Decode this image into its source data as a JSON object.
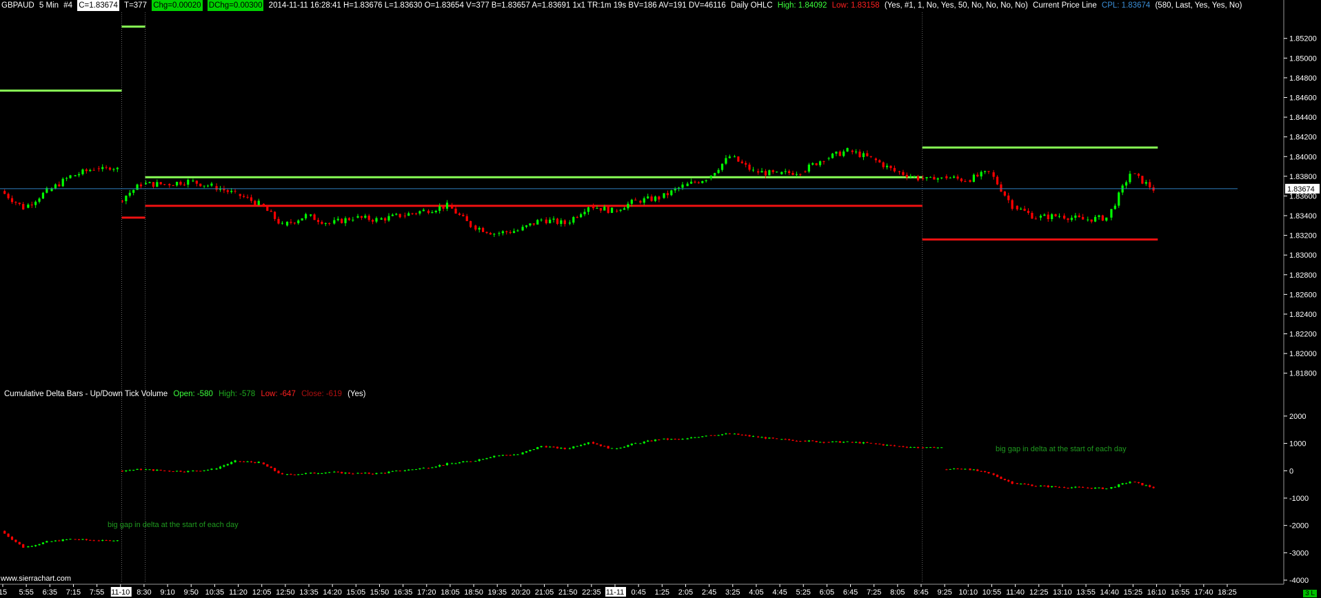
{
  "header": {
    "symbol": "GBPAUD",
    "interval": "5 Min",
    "chart_num": "#4",
    "close_box": "C=1.83674",
    "ticks": "T=377",
    "chg_box": "Chg=0.00020",
    "dchg_box": "DChg=0.00300",
    "bar_info": "2014-11-11 16:28:41 H=1.83676 L=1.83630 O=1.83654 V=377 B=1.83657 A=1.83691 1x1 TR:1m 19s BV=186 AV=191 DV=46116",
    "ohlc_title": "Daily OHLC",
    "ohlc_high": "High: 1.84092",
    "ohlc_low": "Low: 1.83158",
    "ohlc_settings": "(Yes, #1, 1, No, Yes, 50, No, No, No, No)",
    "cpl_title": "Current Price Line",
    "cpl_value": "CPL: 1.83674",
    "cpl_settings": "(580, Last, Yes, Yes, No)"
  },
  "subgraph": {
    "title": "Cumulative Delta Bars - Up/Down Tick Volume",
    "open": "Open: -580",
    "high": "High: -578",
    "low": "Low: -647",
    "close": "Close: -619",
    "settings": "(Yes)"
  },
  "annotations": {
    "note_1": "big gap in delta at the start of each day",
    "note_2": "big gap in delta at the start of each day"
  },
  "watermark": "www.sierrachart.com",
  "corner_tag": "3 L",
  "colors": {
    "up": "#00ff00",
    "down": "#ff0000",
    "cpl": "#2f7fc0",
    "high_line": "#88ff55",
    "low_line": "#ee1111",
    "scale_text": "#ffffff"
  },
  "chart_data": [
    {
      "type": "candlestick",
      "name": "GBPAUD 5 Min",
      "ylim": [
        1.817,
        1.8545
      ],
      "y_ticks": [
        1.852,
        1.85,
        1.848,
        1.846,
        1.844,
        1.842,
        1.84,
        1.838,
        1.836,
        1.834,
        1.832,
        1.83,
        1.828,
        1.826,
        1.824,
        1.822,
        1.82,
        1.818
      ],
      "current_price": 1.83674,
      "current_price_label": "1.83674",
      "x_ticks": [
        "15",
        "5:55",
        "6:35",
        "7:15",
        "7:55",
        "11-10",
        "8:30",
        "9:10",
        "9:50",
        "10:35",
        "11:20",
        "12:05",
        "12:50",
        "13:35",
        "14:20",
        "15:05",
        "15:50",
        "16:35",
        "17:20",
        "18:05",
        "18:50",
        "19:35",
        "20:20",
        "21:05",
        "21:50",
        "22:35",
        "11-11",
        "0:45",
        "1:25",
        "2:05",
        "2:45",
        "3:25",
        "4:05",
        "4:45",
        "5:25",
        "6:05",
        "6:45",
        "7:25",
        "8:05",
        "8:45",
        "9:25",
        "10:10",
        "10:55",
        "11:40",
        "12:25",
        "13:10",
        "13:55",
        "14:40",
        "15:25",
        "16:10",
        "16:55",
        "17:40",
        "18:25"
      ],
      "highlighted_x_ticks": [
        "11-10",
        "11-11"
      ],
      "session_starts": [
        "11-10",
        "8:30",
        "8:45"
      ],
      "price_path": [
        {
          "x": "15",
          "y": 1.8365
        },
        {
          "x": "5:55",
          "y": 1.8348
        },
        {
          "x": "6:35",
          "y": 1.8365
        },
        {
          "x": "7:15",
          "y": 1.838
        },
        {
          "x": "7:55",
          "y": 1.8388
        },
        {
          "x": "11-10",
          "y": 1.8355
        },
        {
          "x": "8:30",
          "y": 1.8372
        },
        {
          "x": "9:10",
          "y": 1.8372
        },
        {
          "x": "9:50",
          "y": 1.8375
        },
        {
          "x": "10:35",
          "y": 1.837
        },
        {
          "x": "11:20",
          "y": 1.8362
        },
        {
          "x": "12:05",
          "y": 1.8352
        },
        {
          "x": "12:50",
          "y": 1.833
        },
        {
          "x": "13:35",
          "y": 1.834
        },
        {
          "x": "14:20",
          "y": 1.8332
        },
        {
          "x": "15:05",
          "y": 1.8338
        },
        {
          "x": "15:50",
          "y": 1.8336
        },
        {
          "x": "16:35",
          "y": 1.834
        },
        {
          "x": "17:20",
          "y": 1.8345
        },
        {
          "x": "18:05",
          "y": 1.835
        },
        {
          "x": "18:50",
          "y": 1.833
        },
        {
          "x": "19:35",
          "y": 1.8322
        },
        {
          "x": "20:20",
          "y": 1.8325
        },
        {
          "x": "21:05",
          "y": 1.8336
        },
        {
          "x": "21:50",
          "y": 1.8332
        },
        {
          "x": "22:35",
          "y": 1.835
        },
        {
          "x": "11-11",
          "y": 1.8345
        },
        {
          "x": "0:45",
          "y": 1.8355
        },
        {
          "x": "1:25",
          "y": 1.8358
        },
        {
          "x": "2:05",
          "y": 1.837
        },
        {
          "x": "2:45",
          "y": 1.8378
        },
        {
          "x": "3:25",
          "y": 1.84
        },
        {
          "x": "4:05",
          "y": 1.8385
        },
        {
          "x": "4:45",
          "y": 1.8382
        },
        {
          "x": "5:25",
          "y": 1.8385
        },
        {
          "x": "6:05",
          "y": 1.8398
        },
        {
          "x": "6:45",
          "y": 1.8406
        },
        {
          "x": "7:25",
          "y": 1.8398
        },
        {
          "x": "8:05",
          "y": 1.8385
        },
        {
          "x": "8:45",
          "y": 1.8378
        },
        {
          "x": "9:25",
          "y": 1.838
        },
        {
          "x": "10:10",
          "y": 1.8376
        },
        {
          "x": "10:55",
          "y": 1.8384
        },
        {
          "x": "11:40",
          "y": 1.835
        },
        {
          "x": "12:25",
          "y": 1.8338
        },
        {
          "x": "13:10",
          "y": 1.834
        },
        {
          "x": "13:55",
          "y": 1.8336
        },
        {
          "x": "14:40",
          "y": 1.8338
        },
        {
          "x": "15:25",
          "y": 1.8383
        },
        {
          "x": "16:10",
          "y": 1.8367
        }
      ],
      "daily_levels": [
        {
          "kind": "high",
          "from": "15",
          "to": "11-10",
          "y": 1.8467
        },
        {
          "kind": "high",
          "from": "11-10",
          "to": "8:30",
          "y": 1.8532
        },
        {
          "kind": "low",
          "from": "11-10",
          "to": "8:30",
          "y": 1.8338
        },
        {
          "kind": "high",
          "from": "8:30",
          "to": "8:45",
          "y": 1.8379
        },
        {
          "kind": "low",
          "from": "8:30",
          "to": "8:45",
          "y": 1.835
        },
        {
          "kind": "high",
          "from": "8:45",
          "to": "16:10",
          "y": 1.84092
        },
        {
          "kind": "low",
          "from": "8:45",
          "to": "16:10",
          "y": 1.83158
        }
      ]
    },
    {
      "type": "candlestick",
      "name": "Cumulative Delta Bars - Up/Down Tick Volume",
      "ylim": [
        -4100,
        2300
      ],
      "y_ticks": [
        2000,
        1000,
        0,
        -1000,
        -2000,
        -3000,
        -4000
      ],
      "delta_path": [
        {
          "x": "15",
          "y": -2200
        },
        {
          "x": "5:55",
          "y": -2800
        },
        {
          "x": "6:35",
          "y": -2600
        },
        {
          "x": "7:15",
          "y": -2500
        },
        {
          "x": "7:55",
          "y": -2550
        },
        {
          "x": "11-10",
          "y": 0
        },
        {
          "x": "8:30",
          "y": 50
        },
        {
          "x": "9:10",
          "y": 0
        },
        {
          "x": "9:50",
          "y": -20
        },
        {
          "x": "10:35",
          "y": 50
        },
        {
          "x": "11:20",
          "y": 350
        },
        {
          "x": "12:05",
          "y": 300
        },
        {
          "x": "12:50",
          "y": -150
        },
        {
          "x": "13:35",
          "y": -100
        },
        {
          "x": "14:20",
          "y": -50
        },
        {
          "x": "15:05",
          "y": -100
        },
        {
          "x": "15:50",
          "y": -100
        },
        {
          "x": "16:35",
          "y": 0
        },
        {
          "x": "17:20",
          "y": 100
        },
        {
          "x": "18:05",
          "y": 250
        },
        {
          "x": "18:50",
          "y": 350
        },
        {
          "x": "19:35",
          "y": 550
        },
        {
          "x": "20:20",
          "y": 600
        },
        {
          "x": "21:05",
          "y": 900
        },
        {
          "x": "21:50",
          "y": 800
        },
        {
          "x": "22:35",
          "y": 1050
        },
        {
          "x": "11-11",
          "y": 800
        },
        {
          "x": "0:45",
          "y": 1000
        },
        {
          "x": "1:25",
          "y": 1150
        },
        {
          "x": "2:05",
          "y": 1150
        },
        {
          "x": "2:45",
          "y": 1300
        },
        {
          "x": "3:25",
          "y": 1350
        },
        {
          "x": "4:05",
          "y": 1250
        },
        {
          "x": "4:45",
          "y": 1150
        },
        {
          "x": "5:25",
          "y": 1100
        },
        {
          "x": "6:05",
          "y": 1050
        },
        {
          "x": "6:45",
          "y": 1050
        },
        {
          "x": "7:25",
          "y": 1000
        },
        {
          "x": "8:05",
          "y": 900
        },
        {
          "x": "8:45",
          "y": 850
        },
        {
          "x": "9:25",
          "y": 50
        },
        {
          "x": "10:10",
          "y": 80
        },
        {
          "x": "10:55",
          "y": -100
        },
        {
          "x": "11:40",
          "y": -450
        },
        {
          "x": "12:25",
          "y": -550
        },
        {
          "x": "13:10",
          "y": -600
        },
        {
          "x": "13:55",
          "y": -620
        },
        {
          "x": "14:40",
          "y": -650
        },
        {
          "x": "15:25",
          "y": -400
        },
        {
          "x": "16:10",
          "y": -619
        }
      ]
    }
  ]
}
